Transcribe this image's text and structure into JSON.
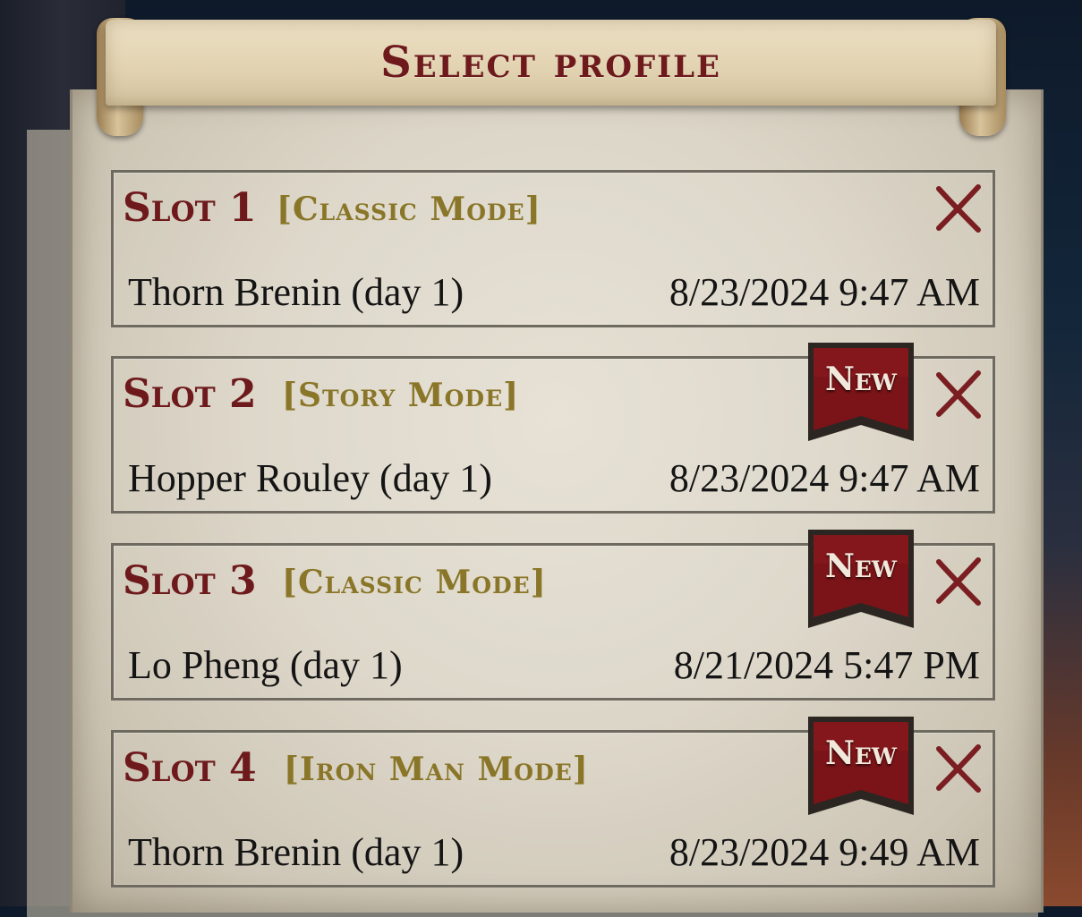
{
  "header": {
    "title": "Select profile"
  },
  "slots": [
    {
      "slot": "Slot 1",
      "mode": "[Classic Mode]",
      "character": "Thorn Brenin (day 1)",
      "date": "8/23/2024 9:47 AM",
      "is_new": false,
      "badge": ""
    },
    {
      "slot": "Slot 2",
      "mode": "[Story Mode]",
      "character": "Hopper Rouley (day 1)",
      "date": "8/23/2024 9:47 AM",
      "is_new": true,
      "badge": "New"
    },
    {
      "slot": "Slot 3",
      "mode": "[Classic Mode]",
      "character": "Lo Pheng (day 1)",
      "date": "8/21/2024 5:47 PM",
      "is_new": true,
      "badge": "New"
    },
    {
      "slot": "Slot 4",
      "mode": "[Iron Man Mode]",
      "character": "Thorn Brenin (day 1)",
      "date": "8/23/2024 9:49 AM",
      "is_new": true,
      "badge": "New"
    }
  ],
  "icons": {
    "delete": "close-x-icon",
    "badge": "new-ribbon-icon"
  },
  "colors": {
    "slot_title": "#6e1a1c",
    "mode": "#8a7628",
    "badge": "#7a1418",
    "delete": "#7a1e22"
  }
}
